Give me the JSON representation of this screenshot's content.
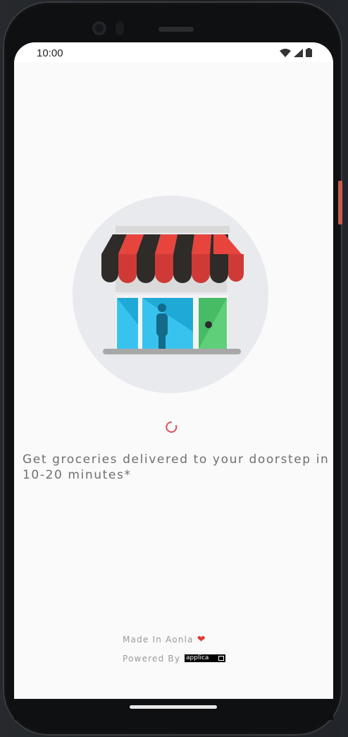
{
  "status_bar": {
    "time": "10:00",
    "icons": [
      "wifi-icon",
      "cell-signal-icon",
      "battery-icon"
    ]
  },
  "splash": {
    "illustration": "storefront-illustration",
    "loading": true,
    "tagline": " Get groceries delivered to your doorstep in 10-20 minutes*"
  },
  "footer": {
    "made_in": "Made In Aonla",
    "powered_by": "Powered By",
    "brand_logo": "applica"
  },
  "colors": {
    "accent": "#e0505b",
    "awning_red": "#e8443e",
    "awning_dark": "#2e2b28",
    "window_blue": "#38c3ef",
    "door_green": "#47bb66",
    "background": "#fafafa"
  }
}
